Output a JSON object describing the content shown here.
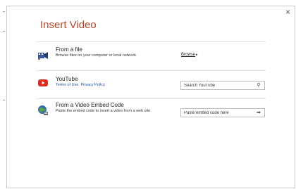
{
  "dialog": {
    "title": "Insert Video",
    "close_glyph": "×"
  },
  "options": {
    "file": {
      "heading": "From a file",
      "subtitle": "Browse files on your computer or local network",
      "browse_label": "Browse",
      "browse_arrow": "▸",
      "icon": "film-icon"
    },
    "youtube": {
      "heading": "YouTube",
      "terms_link": "Terms of Use.",
      "privacy_link": "Privacy Policy.",
      "placeholder": "Search YouTube",
      "search_glyph": "⚲",
      "icon": "youtube-icon",
      "brand_color": "#e02a20"
    },
    "embed": {
      "heading": "From a Video Embed Code",
      "subtitle": "Paste the embed code to insert a video from a web site",
      "placeholder": "Paste embed code here",
      "go_glyph": "➡",
      "icon": "globe-icon"
    }
  },
  "colors": {
    "title": "#b7472a",
    "link": "#1f4e9c"
  }
}
